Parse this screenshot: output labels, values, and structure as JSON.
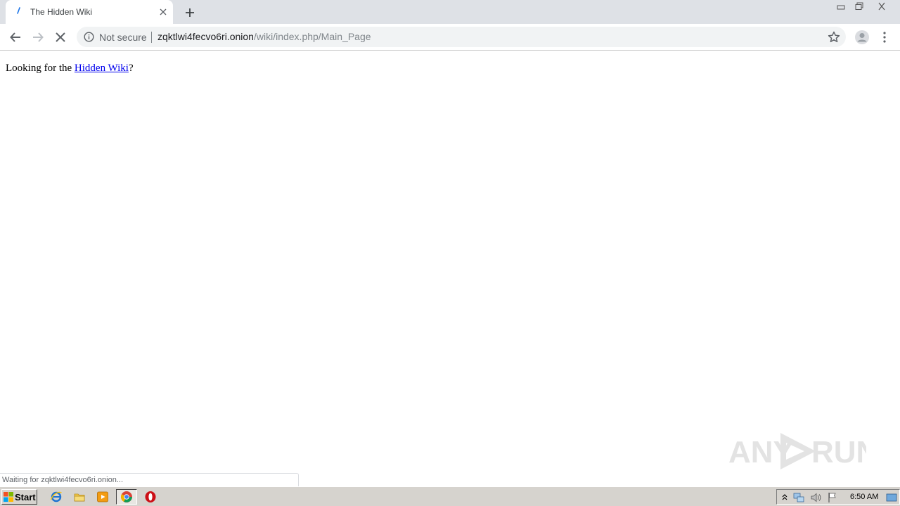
{
  "tab": {
    "title": "The Hidden Wiki",
    "close_label": "×",
    "new_tab_label": "+"
  },
  "window_controls": {
    "minimize": "minimize",
    "maximize": "restore",
    "close": "close"
  },
  "toolbar": {
    "security_label": "Not secure",
    "url_host": "zqktlwi4fecvo6ri.onion",
    "url_path": "/wiki/index.php/Main_Page"
  },
  "page": {
    "text_before": "Looking for the ",
    "link_text": "Hidden Wiki",
    "text_after": "?"
  },
  "status": {
    "text": "Waiting for zqktlwi4fecvo6ri.onion..."
  },
  "watermark": {
    "text_left": "ANY",
    "text_right": "RUN"
  },
  "taskbar": {
    "start_label": "Start",
    "apps": [
      "ie-icon",
      "explorer-icon",
      "media-player-icon",
      "chrome-icon",
      "opera-icon"
    ],
    "clock": "6:50 AM"
  },
  "colors": {
    "link": "#0000ee",
    "tabstrip": "#dee1e6",
    "taskbar": "#d6d3ce"
  }
}
